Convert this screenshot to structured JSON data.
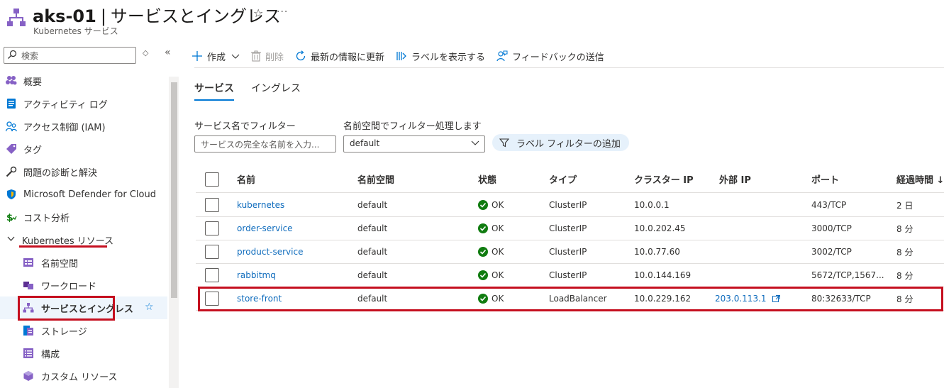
{
  "header": {
    "resource_name": "aks-01",
    "separator": "|",
    "section_title": "サービスとイングレス",
    "subtitle": "Kubernetes サービス"
  },
  "sidebar": {
    "search_placeholder": "検索",
    "items": [
      {
        "label": "概要",
        "icon": "overview-icon"
      },
      {
        "label": "アクティビティ ログ",
        "icon": "activity-log-icon"
      },
      {
        "label": "アクセス制御 (IAM)",
        "icon": "iam-icon"
      },
      {
        "label": "タグ",
        "icon": "tag-icon"
      },
      {
        "label": "問題の診断と解決",
        "icon": "wrench-icon"
      },
      {
        "label": "Microsoft Defender for Cloud",
        "icon": "shield-icon"
      },
      {
        "label": "コスト分析",
        "icon": "cost-icon"
      }
    ],
    "group": {
      "label": "Kubernetes リソース"
    },
    "subitems": [
      {
        "label": "名前空間",
        "icon": "namespace-icon"
      },
      {
        "label": "ワークロード",
        "icon": "workload-icon"
      },
      {
        "label": "サービスとイングレス",
        "icon": "services-icon",
        "selected": true
      },
      {
        "label": "ストレージ",
        "icon": "storage-icon"
      },
      {
        "label": "構成",
        "icon": "config-icon"
      },
      {
        "label": "カスタム リソース",
        "icon": "custom-resource-icon"
      }
    ]
  },
  "toolbar": {
    "create": "作成",
    "delete": "削除",
    "refresh": "最新の情報に更新",
    "show_labels": "ラベルを表示する",
    "feedback": "フィードバックの送信"
  },
  "tabs": [
    {
      "label": "サービス",
      "active": true
    },
    {
      "label": "イングレス",
      "active": false
    }
  ],
  "filters": {
    "service_label": "サービス名でフィルター",
    "service_placeholder": "サービスの完全な名前を入力...",
    "namespace_label": "名前空間でフィルター処理します",
    "namespace_value": "default",
    "add_label_filter": "ラベル フィルターの追加"
  },
  "table": {
    "columns": [
      "名前",
      "名前空間",
      "状態",
      "タイプ",
      "クラスター IP",
      "外部 IP",
      "ポート",
      "経過時間 ↓"
    ],
    "rows": [
      {
        "name": "kubernetes",
        "namespace": "default",
        "status": "OK",
        "type": "ClusterIP",
        "cluster_ip": "10.0.0.1",
        "external_ip": "",
        "ports": "443/TCP",
        "age": "2 日"
      },
      {
        "name": "order-service",
        "namespace": "default",
        "status": "OK",
        "type": "ClusterIP",
        "cluster_ip": "10.0.202.45",
        "external_ip": "",
        "ports": "3000/TCP",
        "age": "8 分"
      },
      {
        "name": "product-service",
        "namespace": "default",
        "status": "OK",
        "type": "ClusterIP",
        "cluster_ip": "10.0.77.60",
        "external_ip": "",
        "ports": "3002/TCP",
        "age": "8 分"
      },
      {
        "name": "rabbitmq",
        "namespace": "default",
        "status": "OK",
        "type": "ClusterIP",
        "cluster_ip": "10.0.144.169",
        "external_ip": "",
        "ports": "5672/TCP,1567...",
        "age": "8 分"
      },
      {
        "name": "store-front",
        "namespace": "default",
        "status": "OK",
        "type": "LoadBalancer",
        "cluster_ip": "10.0.229.162",
        "external_ip": "203.0.113.1",
        "ports": "80:32633/TCP",
        "age": "8 分"
      }
    ]
  },
  "colors": {
    "accent": "#0078d4",
    "link": "#0f6cbd",
    "highlight_red": "#c50f1f",
    "ok_green": "#107c10"
  }
}
